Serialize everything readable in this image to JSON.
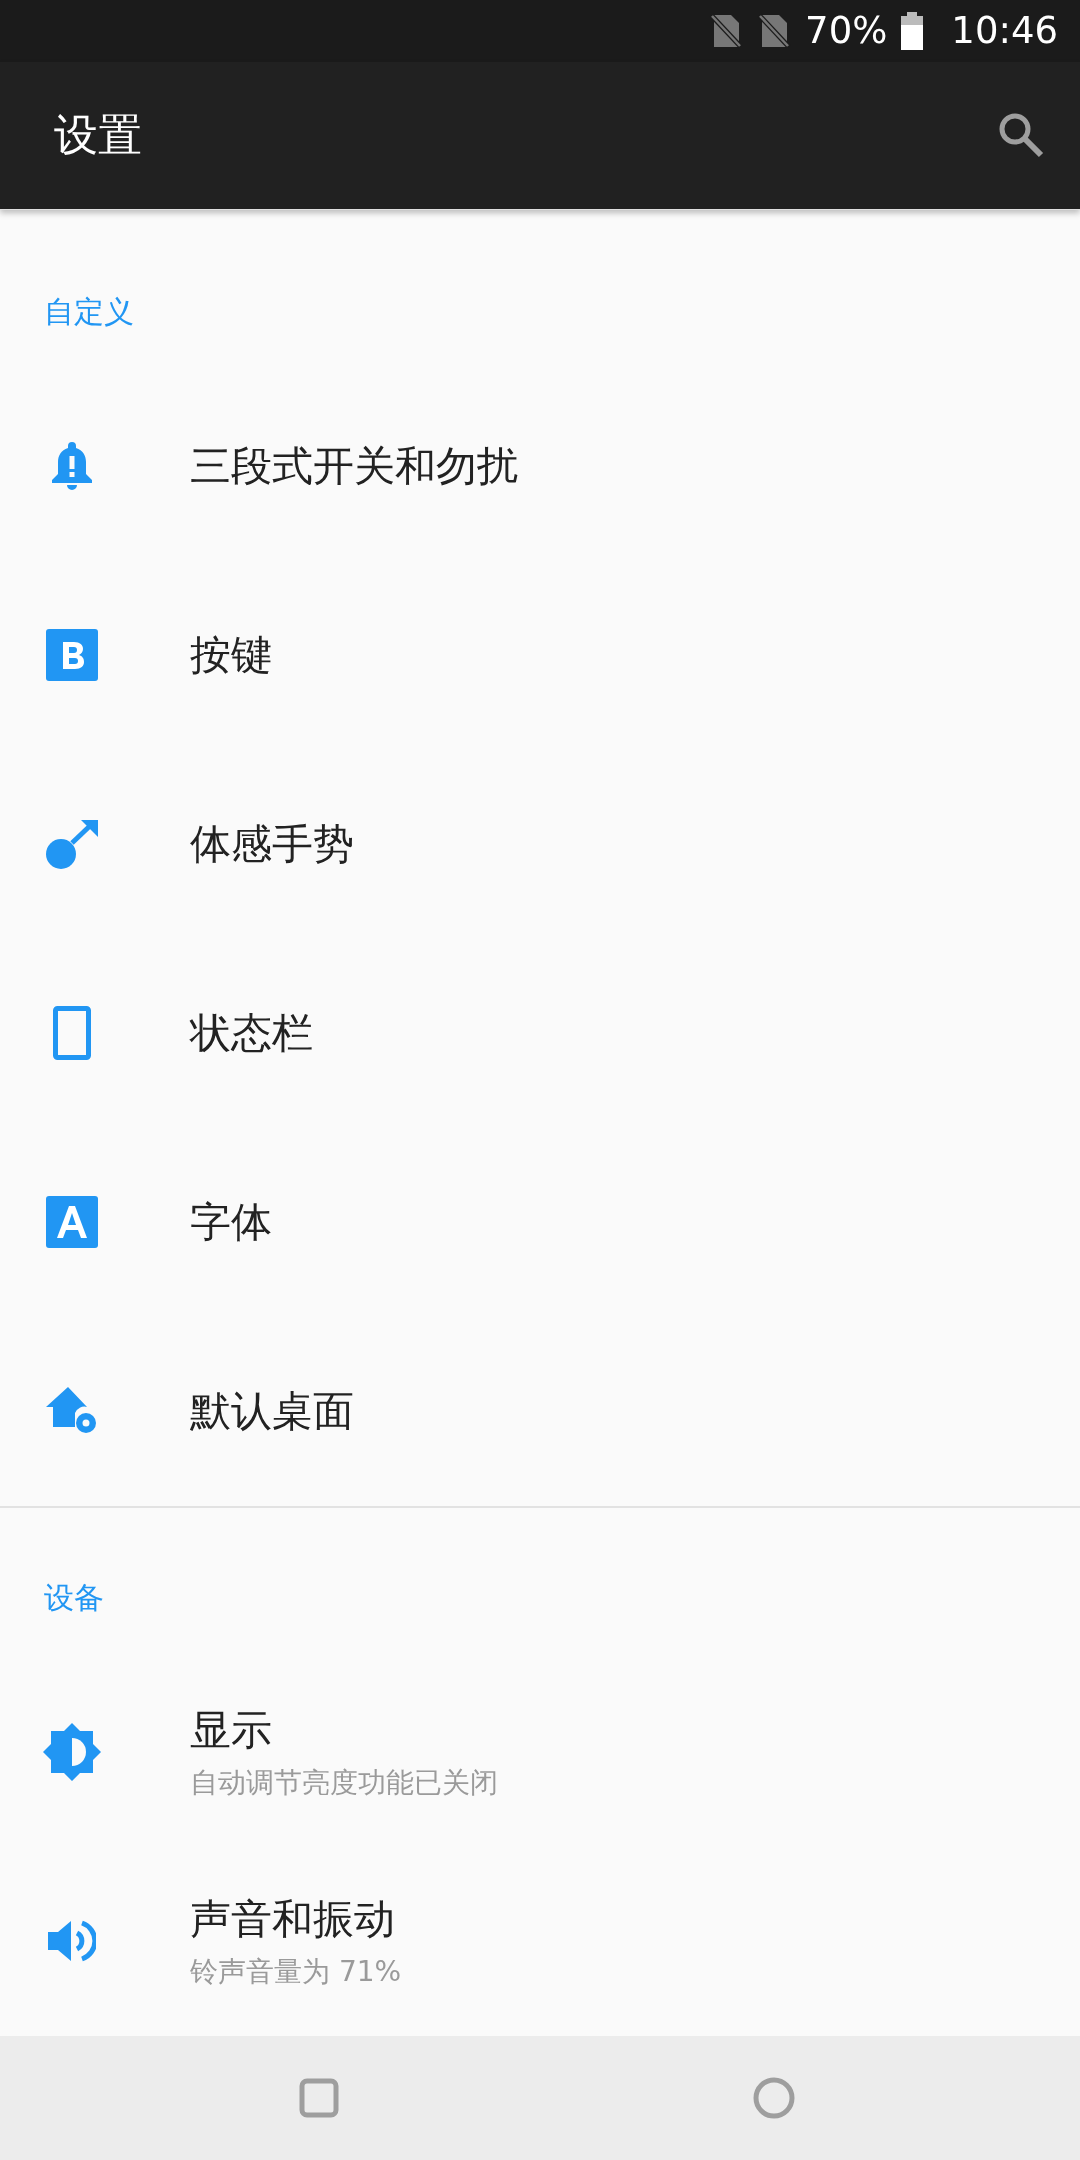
{
  "status_bar": {
    "battery_text": "70%",
    "time": "10:46"
  },
  "toolbar": {
    "title": "设置"
  },
  "sections": [
    {
      "title": "自定义",
      "items": [
        {
          "kind": "bell",
          "label": "三段式开关和勿扰"
        },
        {
          "kind": "key-b",
          "label": "按键"
        },
        {
          "kind": "gesture",
          "label": "体感手势"
        },
        {
          "kind": "phone",
          "label": "状态栏"
        },
        {
          "kind": "font-a",
          "label": "字体"
        },
        {
          "kind": "home",
          "label": "默认桌面"
        }
      ]
    },
    {
      "title": "设备",
      "items": [
        {
          "kind": "brightness",
          "label": "显示",
          "summary": "自动调节亮度功能已关闭"
        },
        {
          "kind": "volume",
          "label": "声音和振动",
          "summary": "铃声音量为 71%"
        }
      ]
    }
  ]
}
